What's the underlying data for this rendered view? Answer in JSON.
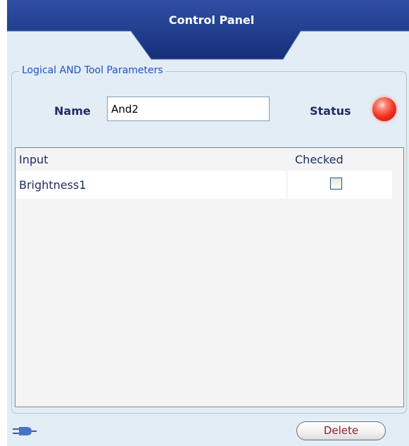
{
  "header": {
    "title": "Control Panel"
  },
  "parameters": {
    "group_title": "Logical AND Tool Parameters",
    "name_label": "Name",
    "name_value": "And2",
    "status_label": "Status",
    "status_color": "#e8321e"
  },
  "inputs_table": {
    "columns": [
      "Input",
      "Checked"
    ],
    "rows": [
      {
        "input": "Brightness1",
        "checked": false
      }
    ]
  },
  "footer": {
    "connector_icon": "plug-icon",
    "delete_label": "Delete"
  }
}
